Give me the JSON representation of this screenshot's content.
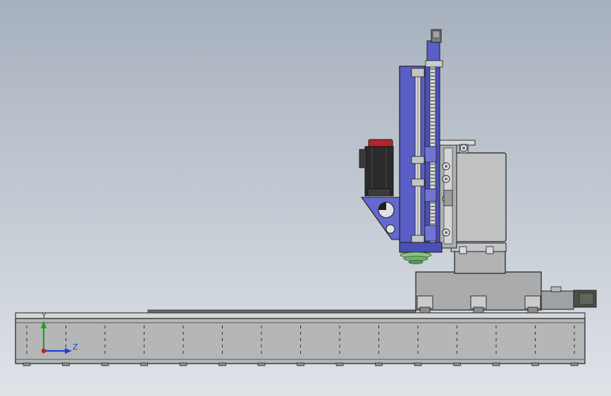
{
  "viewport": {
    "background_top": "#a6b0bd",
    "background_bottom": "#dfe3e8"
  },
  "colors": {
    "steel_light": "#c4c6c8",
    "steel": "#a9abad",
    "steel_dark": "#8a8c8e",
    "outline": "#1e1e1e",
    "column_blue": "#5a5fc6",
    "column_blue_dark": "#3f43a0",
    "motor_black": "#2b2b2b",
    "motor_red": "#b3262a",
    "spindle_green": "#6fae6a",
    "axis_x": "#d01818",
    "axis_y": "#22a022",
    "axis_z": "#2240d0"
  },
  "triad": {
    "y_label": "Y",
    "z_label": "Z"
  }
}
